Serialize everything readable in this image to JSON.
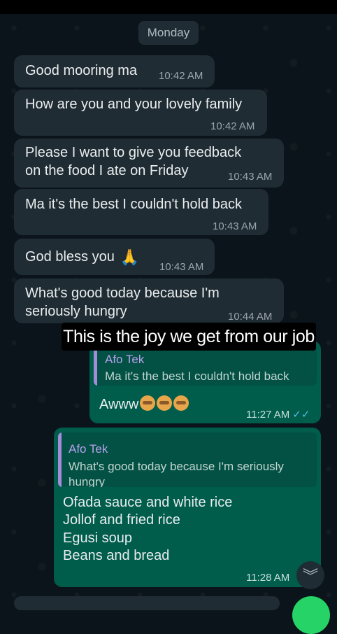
{
  "date_chip": "Monday",
  "caption": "This is the joy we get from our job",
  "messages": [
    {
      "text": "Good mooring ma",
      "time": "10:42 AM"
    },
    {
      "text": "How are you and your lovely family",
      "time": "10:42 AM"
    },
    {
      "text_line1": "Please I want to give you feedback",
      "text_line2": "on the food I ate on Friday",
      "time": "10:43 AM"
    },
    {
      "text": "Ma it's the best I couldn't hold back",
      "time": "10:43 AM"
    },
    {
      "text": "God bless you",
      "emoji": "🙏",
      "time": "10:43 AM"
    },
    {
      "text_line1": "What's good today because I'm",
      "text_line2": "seriously hungry",
      "time": "10:44 AM"
    }
  ],
  "reply1": {
    "quote_name": "Afo Tek",
    "quote_text": "Ma it's the best I couldn't hold back",
    "text": "Awww",
    "time": "11:27 AM",
    "status": "read-double-tick-icon"
  },
  "reply2": {
    "quote_name": "Afo Tek",
    "quote_line1": "What's good today because I'm seriously",
    "quote_line2": "hungry",
    "lines": [
      "Ofada sauce and white rice",
      "Jollof and fried rice",
      "Egusi soup",
      "Beans and bread"
    ],
    "time": "11:28 AM"
  },
  "colors": {
    "background": "#0b141a",
    "incoming_bubble": "#202c33",
    "outgoing_bubble": "#005c4b",
    "quote_accent": "#a58bd9",
    "read_tick": "#53bdeb",
    "fab": "#25d366"
  }
}
